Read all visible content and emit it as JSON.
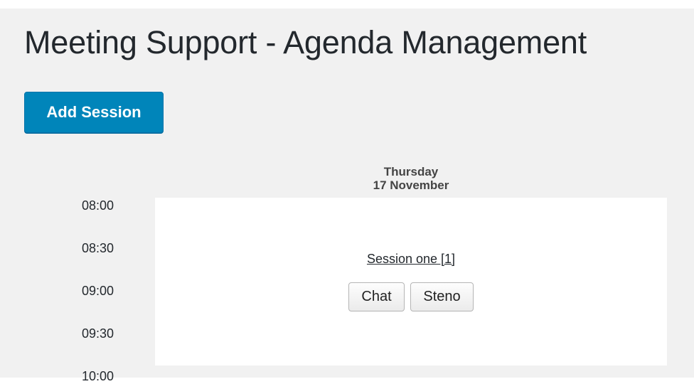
{
  "page": {
    "title": "Meeting Support - Agenda Management"
  },
  "toolbar": {
    "add_session_label": "Add Session"
  },
  "agenda": {
    "day": {
      "weekday": "Thursday",
      "date": "17 November"
    },
    "times": [
      "08:00",
      "08:30",
      "09:00",
      "09:30",
      "10:00"
    ],
    "session": {
      "title": "Session one [1]",
      "buttons": [
        "Chat",
        "Steno"
      ]
    }
  },
  "colors": {
    "page_background": "#f1f1f1",
    "primary_button": "#0085ba",
    "calendar_background": "#ffffff"
  }
}
